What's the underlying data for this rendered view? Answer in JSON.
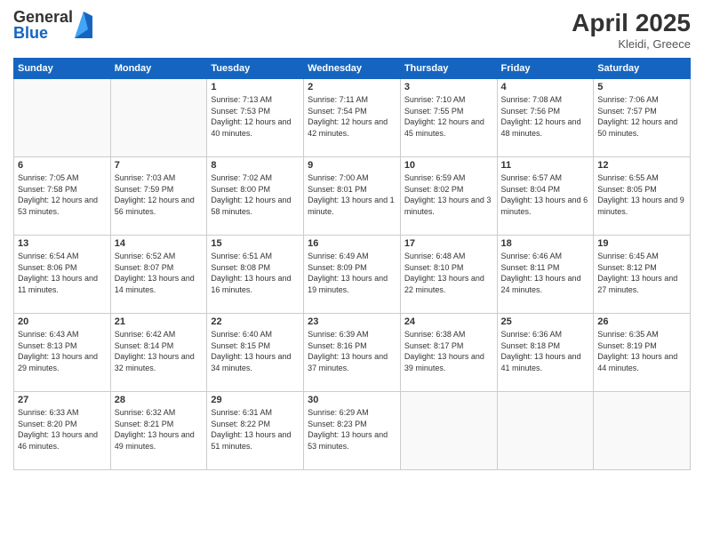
{
  "header": {
    "logo_general": "General",
    "logo_blue": "Blue",
    "title": "April 2025",
    "location": "Kleidi, Greece"
  },
  "weekdays": [
    "Sunday",
    "Monday",
    "Tuesday",
    "Wednesday",
    "Thursday",
    "Friday",
    "Saturday"
  ],
  "weeks": [
    [
      {
        "day": "",
        "info": ""
      },
      {
        "day": "",
        "info": ""
      },
      {
        "day": "1",
        "info": "Sunrise: 7:13 AM\nSunset: 7:53 PM\nDaylight: 12 hours and 40 minutes."
      },
      {
        "day": "2",
        "info": "Sunrise: 7:11 AM\nSunset: 7:54 PM\nDaylight: 12 hours and 42 minutes."
      },
      {
        "day": "3",
        "info": "Sunrise: 7:10 AM\nSunset: 7:55 PM\nDaylight: 12 hours and 45 minutes."
      },
      {
        "day": "4",
        "info": "Sunrise: 7:08 AM\nSunset: 7:56 PM\nDaylight: 12 hours and 48 minutes."
      },
      {
        "day": "5",
        "info": "Sunrise: 7:06 AM\nSunset: 7:57 PM\nDaylight: 12 hours and 50 minutes."
      }
    ],
    [
      {
        "day": "6",
        "info": "Sunrise: 7:05 AM\nSunset: 7:58 PM\nDaylight: 12 hours and 53 minutes."
      },
      {
        "day": "7",
        "info": "Sunrise: 7:03 AM\nSunset: 7:59 PM\nDaylight: 12 hours and 56 minutes."
      },
      {
        "day": "8",
        "info": "Sunrise: 7:02 AM\nSunset: 8:00 PM\nDaylight: 12 hours and 58 minutes."
      },
      {
        "day": "9",
        "info": "Sunrise: 7:00 AM\nSunset: 8:01 PM\nDaylight: 13 hours and 1 minute."
      },
      {
        "day": "10",
        "info": "Sunrise: 6:59 AM\nSunset: 8:02 PM\nDaylight: 13 hours and 3 minutes."
      },
      {
        "day": "11",
        "info": "Sunrise: 6:57 AM\nSunset: 8:04 PM\nDaylight: 13 hours and 6 minutes."
      },
      {
        "day": "12",
        "info": "Sunrise: 6:55 AM\nSunset: 8:05 PM\nDaylight: 13 hours and 9 minutes."
      }
    ],
    [
      {
        "day": "13",
        "info": "Sunrise: 6:54 AM\nSunset: 8:06 PM\nDaylight: 13 hours and 11 minutes."
      },
      {
        "day": "14",
        "info": "Sunrise: 6:52 AM\nSunset: 8:07 PM\nDaylight: 13 hours and 14 minutes."
      },
      {
        "day": "15",
        "info": "Sunrise: 6:51 AM\nSunset: 8:08 PM\nDaylight: 13 hours and 16 minutes."
      },
      {
        "day": "16",
        "info": "Sunrise: 6:49 AM\nSunset: 8:09 PM\nDaylight: 13 hours and 19 minutes."
      },
      {
        "day": "17",
        "info": "Sunrise: 6:48 AM\nSunset: 8:10 PM\nDaylight: 13 hours and 22 minutes."
      },
      {
        "day": "18",
        "info": "Sunrise: 6:46 AM\nSunset: 8:11 PM\nDaylight: 13 hours and 24 minutes."
      },
      {
        "day": "19",
        "info": "Sunrise: 6:45 AM\nSunset: 8:12 PM\nDaylight: 13 hours and 27 minutes."
      }
    ],
    [
      {
        "day": "20",
        "info": "Sunrise: 6:43 AM\nSunset: 8:13 PM\nDaylight: 13 hours and 29 minutes."
      },
      {
        "day": "21",
        "info": "Sunrise: 6:42 AM\nSunset: 8:14 PM\nDaylight: 13 hours and 32 minutes."
      },
      {
        "day": "22",
        "info": "Sunrise: 6:40 AM\nSunset: 8:15 PM\nDaylight: 13 hours and 34 minutes."
      },
      {
        "day": "23",
        "info": "Sunrise: 6:39 AM\nSunset: 8:16 PM\nDaylight: 13 hours and 37 minutes."
      },
      {
        "day": "24",
        "info": "Sunrise: 6:38 AM\nSunset: 8:17 PM\nDaylight: 13 hours and 39 minutes."
      },
      {
        "day": "25",
        "info": "Sunrise: 6:36 AM\nSunset: 8:18 PM\nDaylight: 13 hours and 41 minutes."
      },
      {
        "day": "26",
        "info": "Sunrise: 6:35 AM\nSunset: 8:19 PM\nDaylight: 13 hours and 44 minutes."
      }
    ],
    [
      {
        "day": "27",
        "info": "Sunrise: 6:33 AM\nSunset: 8:20 PM\nDaylight: 13 hours and 46 minutes."
      },
      {
        "day": "28",
        "info": "Sunrise: 6:32 AM\nSunset: 8:21 PM\nDaylight: 13 hours and 49 minutes."
      },
      {
        "day": "29",
        "info": "Sunrise: 6:31 AM\nSunset: 8:22 PM\nDaylight: 13 hours and 51 minutes."
      },
      {
        "day": "30",
        "info": "Sunrise: 6:29 AM\nSunset: 8:23 PM\nDaylight: 13 hours and 53 minutes."
      },
      {
        "day": "",
        "info": ""
      },
      {
        "day": "",
        "info": ""
      },
      {
        "day": "",
        "info": ""
      }
    ]
  ]
}
